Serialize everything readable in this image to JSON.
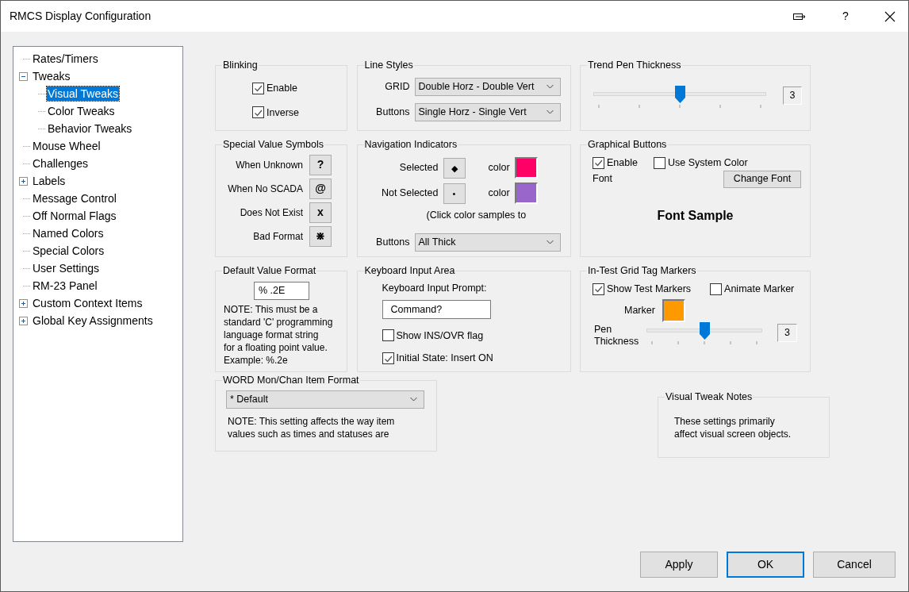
{
  "window": {
    "title": "RMCS Display Configuration",
    "help": "?"
  },
  "tree": [
    {
      "label": "Rates/Timers",
      "selected": false
    },
    {
      "label": "Tweaks",
      "expanded": true,
      "selected": false,
      "children": [
        {
          "label": "Visual Tweaks",
          "selected": true
        },
        {
          "label": "Color Tweaks",
          "selected": false
        },
        {
          "label": "Behavior Tweaks",
          "selected": false
        }
      ]
    },
    {
      "label": "Mouse Wheel",
      "selected": false
    },
    {
      "label": "Challenges",
      "selected": false
    },
    {
      "label": "Labels",
      "expanded": false,
      "selected": false
    },
    {
      "label": "Message Control",
      "selected": false
    },
    {
      "label": "Off Normal Flags",
      "selected": false
    },
    {
      "label": "Named Colors",
      "selected": false
    },
    {
      "label": "Special Colors",
      "selected": false
    },
    {
      "label": "User Settings",
      "selected": false
    },
    {
      "label": "RM-23 Panel",
      "selected": false
    },
    {
      "label": "Custom Context Items",
      "expanded": false,
      "selected": false
    },
    {
      "label": "Global Key Assignments",
      "expanded": false,
      "selected": false
    }
  ],
  "blinking": {
    "title": "Blinking",
    "options": [
      {
        "label": "Enable",
        "checked": true
      },
      {
        "label": "Inverse",
        "checked": true
      }
    ]
  },
  "line_styles": {
    "title": "Line Styles",
    "fields": [
      {
        "label": "GRID",
        "value": "Double Horz - Double Vert"
      },
      {
        "label": "Buttons",
        "value": "Single Horz - Single Vert"
      }
    ]
  },
  "trend_pen_thickness": {
    "title": "Trend Pen Thickness",
    "level": 0.5,
    "value": "3"
  },
  "special_value_symbols": {
    "title": "Special Value Symbols",
    "rows": [
      {
        "label": "When Unknown",
        "symbol": "?"
      },
      {
        "label": "When No SCADA",
        "symbol": "@"
      },
      {
        "label": "Does Not Exist",
        "symbol": "x"
      },
      {
        "label": "Bad Format",
        "symbol": "⋇"
      }
    ]
  },
  "navigation_indicators": {
    "title": "Navigation Indicators",
    "rows": [
      {
        "label": "Selected",
        "symbol": "◆",
        "color_label": "color",
        "color": "#ff0066"
      },
      {
        "label": "Not Selected",
        "symbol": "•",
        "color_label": "color",
        "color": "#9966cc"
      }
    ],
    "note": "(Click color samples to",
    "buttons": {
      "label": "Buttons",
      "value": "All Thick"
    }
  },
  "graphical_buttons": {
    "title": "Graphical Buttons",
    "options": [
      {
        "label": "Enable",
        "checked": true
      },
      {
        "label": "Use System Color",
        "checked": false
      }
    ],
    "font_label": "Font",
    "change_font": "Change Font",
    "font_sample": "Font Sample"
  },
  "default_value_format": {
    "title": "Default Value Format",
    "value": "% .2E",
    "note_lines": [
      "NOTE:  This must be a",
      "standard 'C' programming",
      "language format string",
      "for a floating point value.",
      "Example: %.2e"
    ]
  },
  "keyboard_input_area": {
    "title": "Keyboard Input Area",
    "prompt_label": "Keyboard Input Prompt:",
    "prompt_value": "Command?",
    "options": [
      {
        "label": "Show INS/OVR flag",
        "checked": false
      },
      {
        "label": "Initial State: Insert ON",
        "checked": true
      }
    ]
  },
  "in_test_grid_tag_markers": {
    "title": "In-Test Grid Tag Markers",
    "options": [
      {
        "label": "Show Test Markers",
        "checked": true
      },
      {
        "label": "Animate Marker",
        "checked": false
      }
    ],
    "marker": {
      "label": "Marker",
      "color": "#ff9900"
    },
    "pen_label_lines": [
      "Pen",
      "Thickness"
    ],
    "level": 0.5,
    "value": "3"
  },
  "word_item_format": {
    "title": "WORD Mon/Chan Item Format",
    "value": "* Default",
    "note_lines": [
      "NOTE:  This setting affects the way item",
      "values such as times and statuses are"
    ]
  },
  "visual_tweak_notes": {
    "title": "Visual Tweak Notes",
    "lines": [
      "These settings primarily",
      "affect visual screen objects."
    ]
  },
  "buttons": [
    {
      "label": "Apply",
      "default": false
    },
    {
      "label": "OK",
      "default": true
    },
    {
      "label": "Cancel",
      "default": false
    }
  ]
}
